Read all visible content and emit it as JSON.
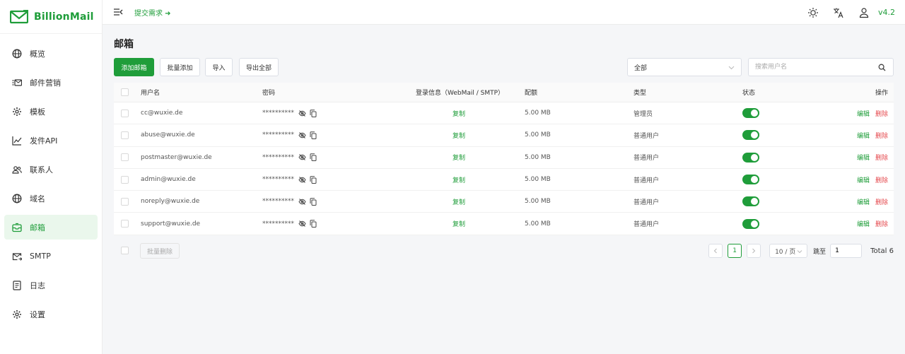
{
  "app": {
    "name": "BillionMail",
    "version": "v4.2",
    "feedback": "提交需求 ➜"
  },
  "colors": {
    "brand": "#1f9d3a",
    "danger": "#e5484d"
  },
  "sidebar": {
    "items": [
      {
        "label": "概览",
        "icon": "globe-icon"
      },
      {
        "label": "邮件营销",
        "icon": "mail-list-icon"
      },
      {
        "label": "模板",
        "icon": "gear-icon"
      },
      {
        "label": "发件API",
        "icon": "chart-line-icon"
      },
      {
        "label": "联系人",
        "icon": "users-icon"
      },
      {
        "label": "域名",
        "icon": "globe-icon"
      },
      {
        "label": "邮箱",
        "icon": "mailbox-icon",
        "active": true
      },
      {
        "label": "SMTP",
        "icon": "mail-send-icon"
      },
      {
        "label": "日志",
        "icon": "log-icon"
      },
      {
        "label": "设置",
        "icon": "gear-icon"
      }
    ]
  },
  "page": {
    "title": "邮箱"
  },
  "toolbar": {
    "add": "添加邮箱",
    "batch_add": "批量添加",
    "import": "导入",
    "export_all": "导出全部",
    "filter_value": "全部",
    "search_placeholder": "搜索用户名"
  },
  "table": {
    "headers": {
      "username": "用户名",
      "password": "密码",
      "login": "登录信息（WebMail / SMTP）",
      "quota": "配额",
      "type": "类型",
      "status": "状态",
      "actions": "操作"
    },
    "rows": [
      {
        "username": "cc@wuxie.de",
        "password": "**********",
        "login": "复制",
        "quota": "5.00 MB",
        "type": "管理员",
        "enabled": true,
        "edit": "编辑",
        "delete": "删除"
      },
      {
        "username": "abuse@wuxie.de",
        "password": "**********",
        "login": "复制",
        "quota": "5.00 MB",
        "type": "普通用户",
        "enabled": true,
        "edit": "编辑",
        "delete": "删除"
      },
      {
        "username": "postmaster@wuxie.de",
        "password": "**********",
        "login": "复制",
        "quota": "5.00 MB",
        "type": "普通用户",
        "enabled": true,
        "edit": "编辑",
        "delete": "删除"
      },
      {
        "username": "admin@wuxie.de",
        "password": "**********",
        "login": "复制",
        "quota": "5.00 MB",
        "type": "普通用户",
        "enabled": true,
        "edit": "编辑",
        "delete": "删除"
      },
      {
        "username": "noreply@wuxie.de",
        "password": "**********",
        "login": "复制",
        "quota": "5.00 MB",
        "type": "普通用户",
        "enabled": true,
        "edit": "编辑",
        "delete": "删除"
      },
      {
        "username": "support@wuxie.de",
        "password": "**********",
        "login": "复制",
        "quota": "5.00 MB",
        "type": "普通用户",
        "enabled": true,
        "edit": "编辑",
        "delete": "删除"
      }
    ]
  },
  "footer": {
    "batch_delete": "批量删除",
    "current_page": "1",
    "page_size": "10 / 页",
    "jump_label": "跳至",
    "jump_value": "1",
    "total": "Total 6"
  }
}
